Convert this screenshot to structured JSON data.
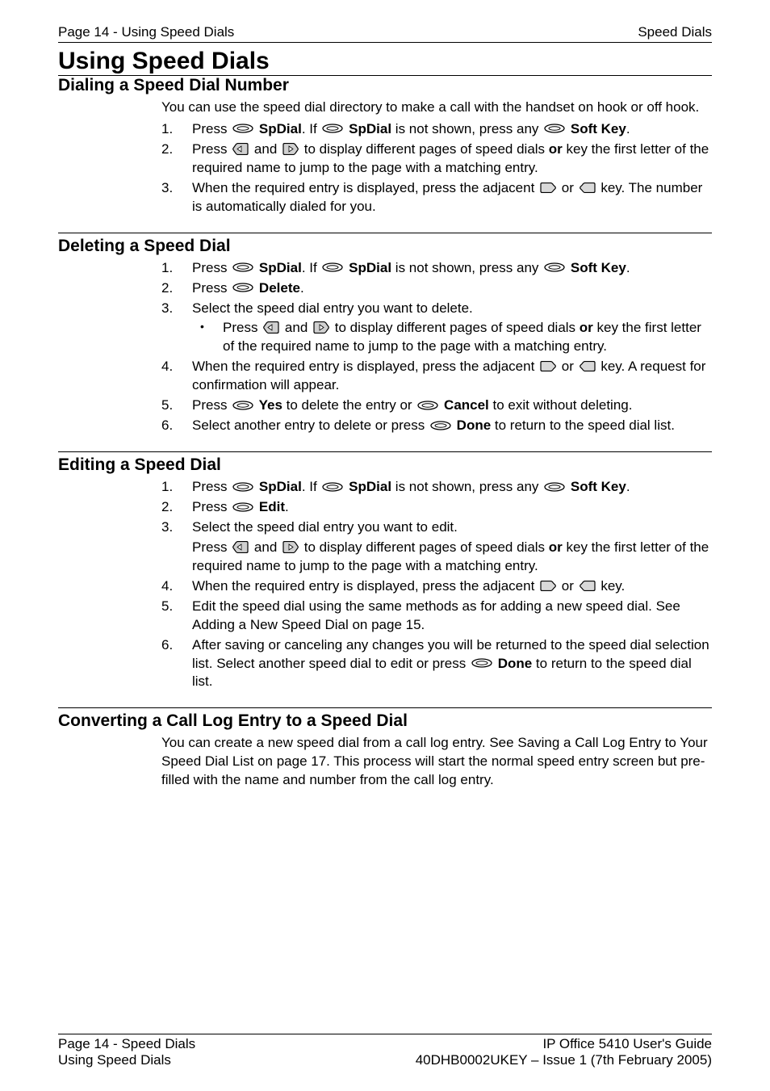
{
  "header": {
    "left": "Page 14 - Using Speed Dials",
    "right": "Speed Dials"
  },
  "title": "Using Speed Dials",
  "sections": {
    "dialing": {
      "title": "Dialing a Speed Dial Number",
      "intro": "You can use the speed dial directory to make a call with the handset on hook or off hook.",
      "s1_a": "Press ",
      "s1_b": " SpDial",
      "s1_c": ". If ",
      "s1_d": " SpDial",
      "s1_e": " is not shown, press any ",
      "s1_f": " Soft Key",
      "s1_g": ".",
      "s2_a": "Press ",
      "s2_b": " and ",
      "s2_c": " to display different pages of speed dials ",
      "s2_d": "or",
      "s2_e": " key the first letter of the required name to jump to the page with a matching entry.",
      "s3_a": "When the required entry is displayed, press the adjacent ",
      "s3_b": " or ",
      "s3_c": " key. The number is automatically dialed for you."
    },
    "deleting": {
      "title": "Deleting a Speed Dial",
      "s1_a": "Press ",
      "s1_b": " SpDial",
      "s1_c": ". If ",
      "s1_d": " SpDial",
      "s1_e": " is not shown, press any ",
      "s1_f": " Soft Key",
      "s1_g": ".",
      "s2_a": "Press ",
      "s2_b": " Delete",
      "s2_c": ".",
      "s3": "Select the speed dial entry you want to delete.",
      "s3b_a": "Press ",
      "s3b_b": " and ",
      "s3b_c": " to display different pages of speed dials ",
      "s3b_d": "or",
      "s3b_e": " key the first letter of the required name to jump to the page with a matching entry.",
      "s4_a": "When the required entry is displayed, press the adjacent ",
      "s4_b": " or ",
      "s4_c": " key. A request for confirmation will appear.",
      "s5_a": "Press ",
      "s5_b": " Yes",
      "s5_c": " to delete the entry or ",
      "s5_d": " Cancel",
      "s5_e": " to exit without deleting.",
      "s6_a": "Select another entry to delete or press ",
      "s6_b": " Done",
      "s6_c": " to return to the speed dial list."
    },
    "editing": {
      "title": "Editing a Speed Dial",
      "s1_a": "Press ",
      "s1_b": " SpDial",
      "s1_c": ". If ",
      "s1_d": " SpDial",
      "s1_e": " is not shown, press any ",
      "s1_f": " Soft Key",
      "s1_g": ".",
      "s2_a": "Press ",
      "s2_b": " Edit",
      "s2_c": ".",
      "s3": "Select the speed dial entry you want to edit.",
      "s3p_a": "Press ",
      "s3p_b": " and ",
      "s3p_c": " to display different pages of speed dials ",
      "s3p_d": "or",
      "s3p_e": " key the first letter of the required name to jump to the page with a matching entry.",
      "s4_a": "When the required entry is displayed, press the adjacent ",
      "s4_b": " or ",
      "s4_c": " key.",
      "s5": "Edit the speed dial using the same methods as for adding a new speed dial. See Adding a New Speed Dial on page 15.",
      "s6_a": "After saving or canceling any changes you will be returned to the speed dial selection list. Select another speed dial to edit or press ",
      "s6_b": " Done",
      "s6_c": " to return to the speed dial list."
    },
    "converting": {
      "title": "Converting a Call Log Entry to a Speed Dial",
      "intro": "You can create a new speed dial from a call log entry. See Saving a Call Log Entry to Your Speed Dial List on page 17. This process will start the normal speed entry screen but pre-filled with the name and number from the call log entry."
    }
  },
  "footer": {
    "left1": "Page 14 - Speed Dials",
    "left2": "Using Speed Dials",
    "right1": "IP Office 5410 User's Guide",
    "right2": "40DHB0002UKEY – Issue 1 (7th February 2005)"
  }
}
